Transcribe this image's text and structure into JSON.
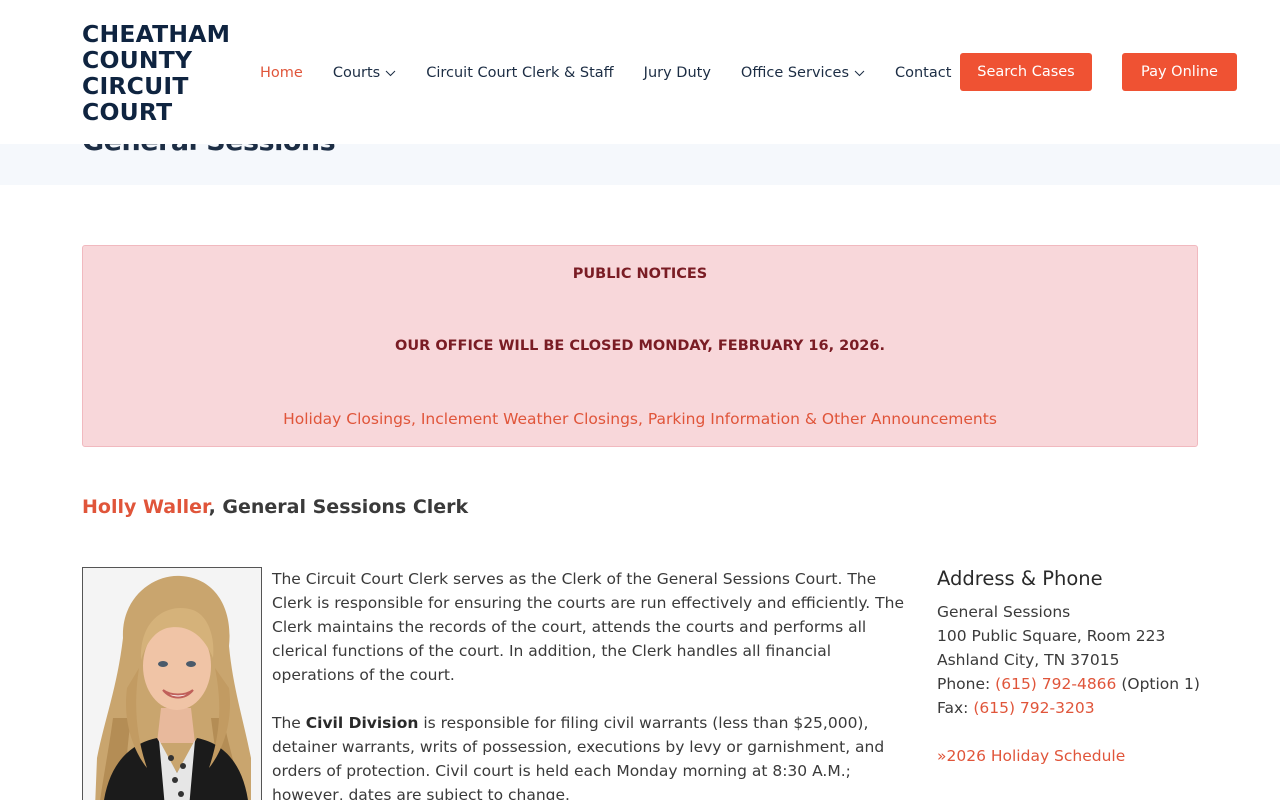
{
  "site": {
    "logo_lines": [
      "CHEATHAM",
      "COUNTY",
      "CIRCUIT",
      "COURT"
    ]
  },
  "nav": {
    "items": [
      {
        "label": "Home",
        "active": true
      },
      {
        "label": "Courts",
        "dropdown": true
      },
      {
        "label": "Circuit Court Clerk & Staff"
      },
      {
        "label": "Jury Duty"
      },
      {
        "label": "Office Services",
        "dropdown": true
      },
      {
        "label": "Contact"
      }
    ],
    "search_cases": "Search Cases",
    "pay_online": "Pay Online"
  },
  "page": {
    "title": "General Sessions"
  },
  "notice": {
    "title": "PUBLIC NOTICES",
    "closed": "OUR OFFICE WILL BE CLOSED MONDAY, FEBRUARY 16, 2026.",
    "link": "Holiday Closings, Inclement Weather Closings, Parking Information & Other Announcements"
  },
  "clerk": {
    "name": "Holly Waller",
    "title_suffix": ", General Sessions Clerk"
  },
  "content": {
    "para1": "The Circuit Court Clerk serves as the Clerk of the General Sessions Court. The Clerk is responsible for ensuring the courts are run effectively and efficiently. The Clerk maintains the records of the court, attends the courts and performs all clerical functions of the court. In addition, the Clerk handles all financial operations of the court.",
    "para2_prefix": "The ",
    "para2_bold": "Civil Division",
    "para2_rest": " is responsible for filing civil warrants (less than $25,000), detainer warrants, writs of possession, executions by levy or garnishment, and orders of protection. Civil court is held each Monday morning at 8:30 A.M.; however, dates are subject to change."
  },
  "sidebar": {
    "heading": "Address & Phone",
    "line1": "General Sessions",
    "line2": "100 Public Square, Room 223",
    "line3": "Ashland City, TN 37015",
    "phone_label": "Phone: ",
    "phone": "(615) 792-4866",
    "phone_suffix": " (Option 1)",
    "fax_label": "Fax: ",
    "fax": "(615) 792-3203",
    "holiday_link": "»2026 Holiday Schedule"
  },
  "colors": {
    "accent": "#ef5233",
    "link": "#e0553a",
    "navy": "#0f2440",
    "notice_bg": "#f8d7da",
    "notice_text": "#7a1c24"
  }
}
